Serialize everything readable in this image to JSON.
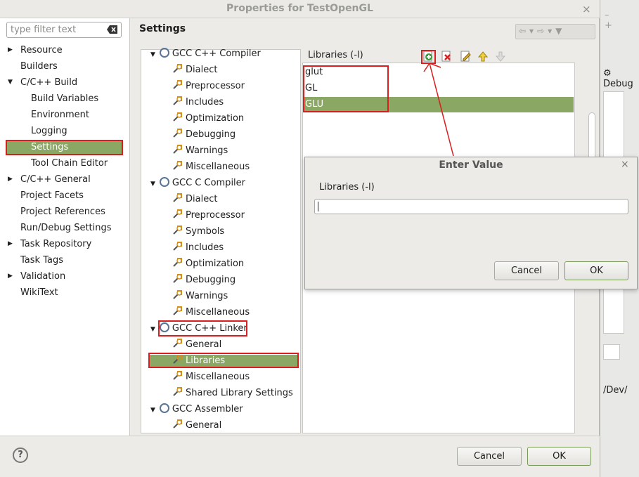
{
  "window": {
    "title": "Properties for TestOpenGL",
    "close": "×"
  },
  "left_nav": {
    "filter_placeholder": "type filter text",
    "items": [
      {
        "label": "Resource",
        "expander": "collapsed"
      },
      {
        "label": "Builders"
      },
      {
        "label": "C/C++ Build",
        "expander": "expanded"
      },
      {
        "label": "Build Variables"
      },
      {
        "label": "Environment"
      },
      {
        "label": "Logging"
      },
      {
        "label": "Settings",
        "selected": true
      },
      {
        "label": "Tool Chain Editor"
      },
      {
        "label": "C/C++ General",
        "expander": "collapsed"
      },
      {
        "label": "Project Facets"
      },
      {
        "label": "Project References"
      },
      {
        "label": "Run/Debug Settings"
      },
      {
        "label": "Task Repository",
        "expander": "collapsed"
      },
      {
        "label": "Task Tags"
      },
      {
        "label": "Validation",
        "expander": "collapsed"
      },
      {
        "label": "WikiText"
      }
    ]
  },
  "main": {
    "title": "Settings"
  },
  "tool_tree": [
    {
      "label": "GCC C++ Compiler",
      "type": "tool"
    },
    {
      "label": "Dialect"
    },
    {
      "label": "Preprocessor"
    },
    {
      "label": "Includes"
    },
    {
      "label": "Optimization"
    },
    {
      "label": "Debugging"
    },
    {
      "label": "Warnings"
    },
    {
      "label": "Miscellaneous"
    },
    {
      "label": "GCC C Compiler",
      "type": "tool"
    },
    {
      "label": "Dialect"
    },
    {
      "label": "Preprocessor"
    },
    {
      "label": "Symbols"
    },
    {
      "label": "Includes"
    },
    {
      "label": "Optimization"
    },
    {
      "label": "Debugging"
    },
    {
      "label": "Warnings"
    },
    {
      "label": "Miscellaneous"
    },
    {
      "label": "GCC C++ Linker",
      "type": "tool"
    },
    {
      "label": "General"
    },
    {
      "label": "Libraries",
      "selected": true
    },
    {
      "label": "Miscellaneous"
    },
    {
      "label": "Shared Library Settings"
    },
    {
      "label": "GCC Assembler",
      "type": "tool"
    },
    {
      "label": "General"
    }
  ],
  "libraries": {
    "header": "Libraries (-l)",
    "items": [
      "glut",
      "GL",
      "GLU"
    ],
    "toolbar": [
      "add-icon",
      "delete-icon",
      "edit-icon",
      "move-up-icon",
      "move-down-icon"
    ]
  },
  "enter_value": {
    "title": "Enter Value",
    "label": "Libraries (-l)",
    "value": "",
    "cancel": "Cancel",
    "ok": "OK"
  },
  "footer": {
    "help": "?",
    "cancel": "Cancel",
    "ok": "OK"
  },
  "background_window": {
    "debug_label": "Debug",
    "path_fragment": "/Dev/"
  },
  "colors": {
    "selection": "#8aa864",
    "highlight": "#d81e1e"
  }
}
